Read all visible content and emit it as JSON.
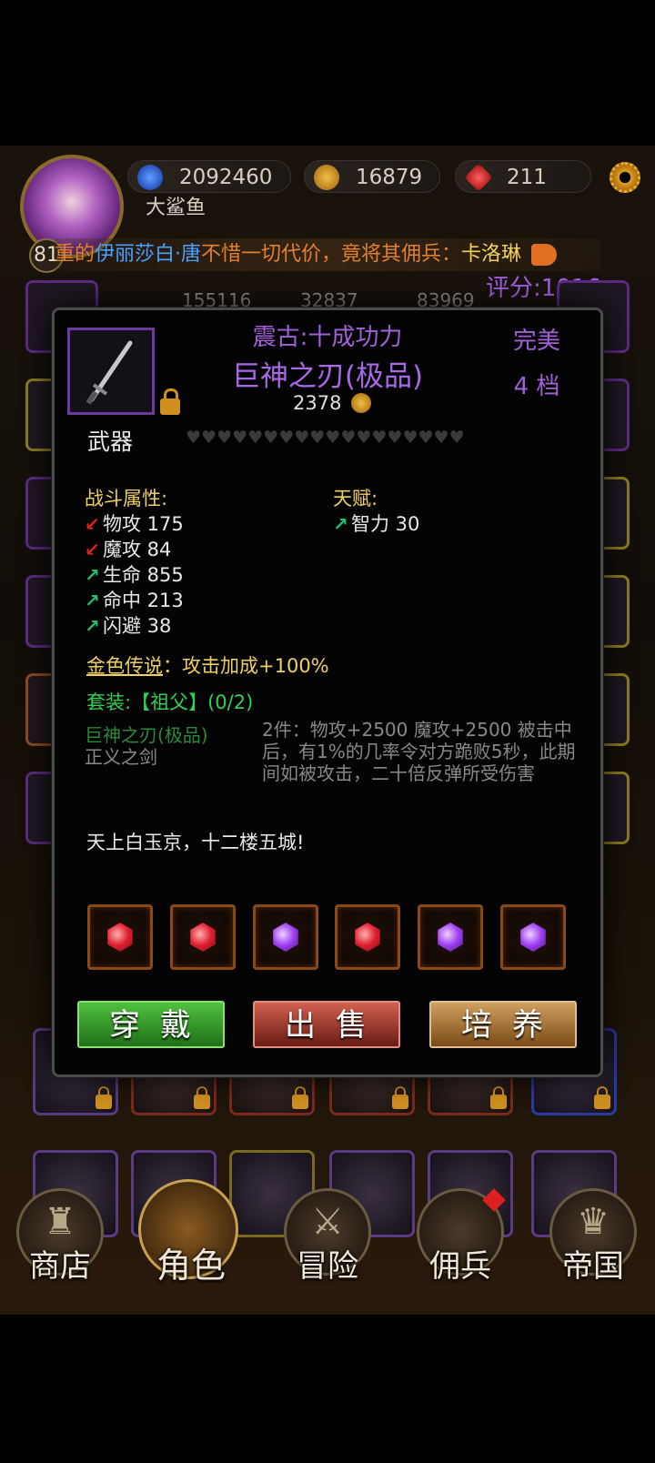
{
  "header": {
    "currency_diamond": "2092460",
    "currency_gold": "16879",
    "currency_ruby": "211",
    "player_name": "大鲨鱼",
    "player_level": "81",
    "score": "评分:1016",
    "icons": [
      "gem-blue-icon",
      "gold-coin-icon",
      "ruby-icon",
      "gear-icon",
      "megaphone-icon"
    ]
  },
  "marquee": {
    "prefix": "重的",
    "name1": "伊丽莎白·唐",
    "middle": "不惜一切代价，竟将其佣兵：",
    "name2": "卡洛琳"
  },
  "background_stats": [
    "155116",
    "32837",
    "83969"
  ],
  "item": {
    "type_label": "武器",
    "prefix": "震古:十成功力",
    "name": "巨神之刃(极品)",
    "price": "2378",
    "quality": "完美",
    "grade": "4 档",
    "hearts": "♥♥♥♥♥♥♥♥♥♥♥♥♥♥♥♥♥♥",
    "combat_title": "战斗属性:",
    "combat_stats": [
      {
        "arrow": "down",
        "label": "物攻 175"
      },
      {
        "arrow": "down",
        "label": "魔攻 84"
      },
      {
        "arrow": "up",
        "label": "生命 855"
      },
      {
        "arrow": "up",
        "label": "命中 213"
      },
      {
        "arrow": "up",
        "label": "闪避 38"
      }
    ],
    "talent_title": "天赋:",
    "talent_stats": [
      {
        "arrow": "up",
        "label": "智力 30"
      }
    ],
    "legend_key": "金色传说",
    "legend_value": "：攻击加成+100%",
    "set_line": "套装:【祖父】(0/2)",
    "set_piece_1": "巨神之刃(极品)",
    "set_piece_2": "正义之剑",
    "set_bonus": "2件：物攻+2500 魔攻+2500 被击中后，有1%的几率令对方跪败5秒，此期间如被攻击，二十倍反弹所受伤害",
    "flavor": "天上白玉京，十二楼五城!",
    "gems": [
      "red",
      "red",
      "purple",
      "red",
      "purple",
      "purple"
    ]
  },
  "buttons": {
    "equip": "穿戴",
    "sell": "出售",
    "upgrade": "培养"
  },
  "nav": {
    "shop": "商店",
    "character": "角色",
    "adventure": "冒险",
    "mercenary": "佣兵",
    "empire": "帝国"
  },
  "colors": {
    "epic_purple": "#a868e8",
    "gold_text": "#f0d060",
    "set_green": "#30d050",
    "stat_up": "#20c070",
    "stat_down": "#e02020"
  }
}
